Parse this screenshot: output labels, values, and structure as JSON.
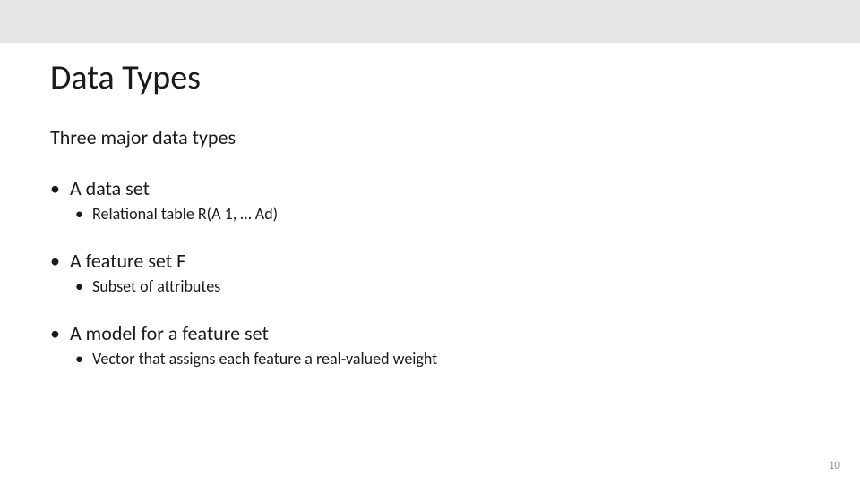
{
  "slide": {
    "title": "Data Types",
    "subtitle": "Three major data types",
    "items": [
      {
        "main": "A data set",
        "sub": "Relational table R(A 1, … Ad)"
      },
      {
        "main": "A feature set F",
        "sub": "Subset of attributes"
      },
      {
        "main": "A model for a feature set",
        "sub": "Vector that assigns each feature a real-valued weight"
      }
    ],
    "page_number": "10"
  }
}
